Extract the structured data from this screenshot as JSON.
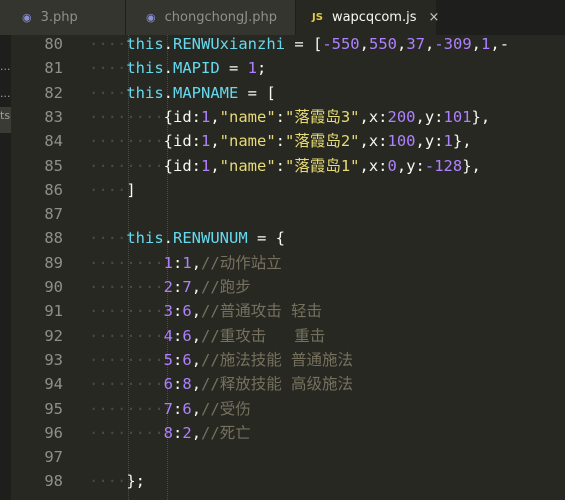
{
  "tabs": [
    {
      "icon": "php-elephant-icon",
      "label": "3.php",
      "active": false
    },
    {
      "icon": "php-elephant-icon",
      "label": "chongchongJ.php",
      "active": false
    },
    {
      "icon": "js-file-icon",
      "icon_text": "JS",
      "label": "wapcqcom.js",
      "active": true,
      "close": "×"
    }
  ],
  "sidebar_fragments": [
    "...",
    "...",
    "ts"
  ],
  "lines": [
    {
      "num": "80",
      "code": "this.RENWUxianzhi = [-550,550,37,-309,1,-"
    },
    {
      "num": "81",
      "code": "this.MAPID = 1;"
    },
    {
      "num": "82",
      "code": "this.MAPNAME = ["
    },
    {
      "num": "83",
      "code": "{id:1,\"name\":\"落霞岛3\",x:200,y:101},"
    },
    {
      "num": "84",
      "code": "{id:1,\"name\":\"落霞岛2\",x:100,y:1},"
    },
    {
      "num": "85",
      "code": "{id:1,\"name\":\"落霞岛1\",x:0,y:-128},"
    },
    {
      "num": "86",
      "code": "]"
    },
    {
      "num": "87",
      "code": ""
    },
    {
      "num": "88",
      "code": "this.RENWUNUM = {"
    },
    {
      "num": "89",
      "code": "1:1,//动作站立"
    },
    {
      "num": "90",
      "code": "2:7,//跑步"
    },
    {
      "num": "91",
      "code": "3:6,//普通攻击 轻击"
    },
    {
      "num": "92",
      "code": "4:6,//重攻击   重击"
    },
    {
      "num": "93",
      "code": "5:6,//施法技能 普通施法"
    },
    {
      "num": "94",
      "code": "6:8,//释放技能 高级施法"
    },
    {
      "num": "95",
      "code": "7:6,//受伤"
    },
    {
      "num": "96",
      "code": "8:2,//死亡"
    },
    {
      "num": "97",
      "code": ""
    },
    {
      "num": "98",
      "code": "};"
    }
  ],
  "colors": {
    "background": "#272822",
    "tabbar": "#1e1f1c",
    "keyword": "#66d9ef",
    "string": "#e6db74",
    "number": "#ae81ff",
    "comment": "#75715e",
    "text": "#f8f8f2",
    "line_number": "#8f908a"
  }
}
